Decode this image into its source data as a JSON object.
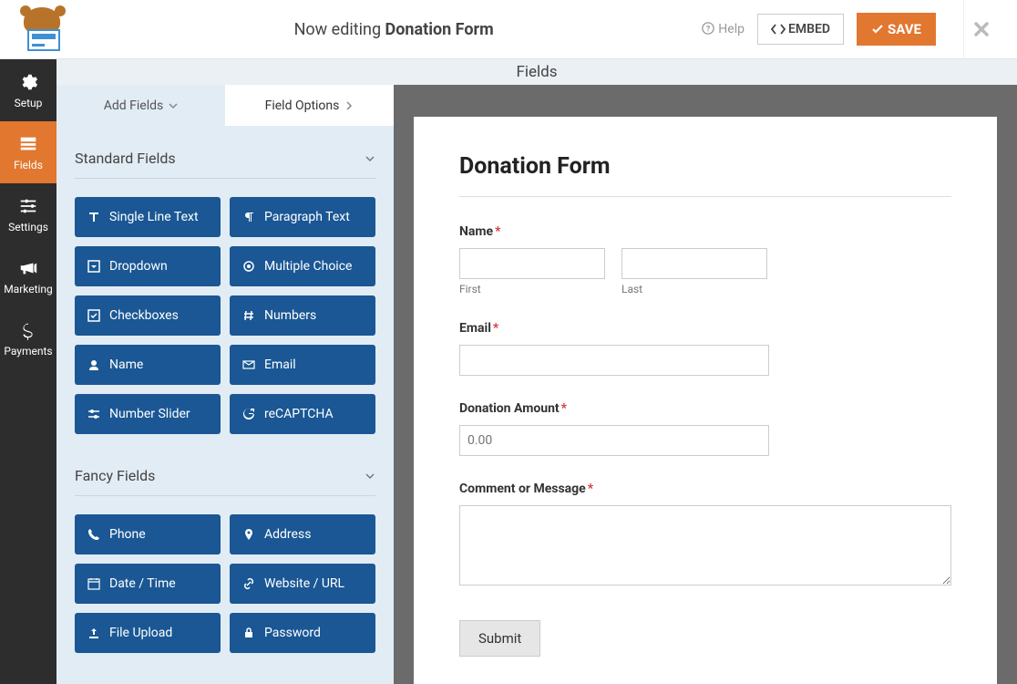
{
  "topbar": {
    "editing_prefix": "Now editing ",
    "form_name": "Donation Form",
    "help": "Help",
    "embed": "EMBED",
    "save": "SAVE"
  },
  "vnav": {
    "setup": "Setup",
    "fields": "Fields",
    "settings": "Settings",
    "marketing": "Marketing",
    "payments": "Payments"
  },
  "strip_title": "Fields",
  "panel_tabs": {
    "add": "Add Fields",
    "options": "Field Options"
  },
  "sections": {
    "standard": "Standard Fields",
    "fancy": "Fancy Fields"
  },
  "standard_fields": {
    "single_line": "Single Line Text",
    "paragraph": "Paragraph Text",
    "dropdown": "Dropdown",
    "multiple_choice": "Multiple Choice",
    "checkboxes": "Checkboxes",
    "numbers": "Numbers",
    "name": "Name",
    "email": "Email",
    "number_slider": "Number Slider",
    "recaptcha": "reCAPTCHA"
  },
  "fancy_fields": {
    "phone": "Phone",
    "address": "Address",
    "date_time": "Date / Time",
    "website_url": "Website / URL",
    "file_upload": "File Upload",
    "password": "Password"
  },
  "preview": {
    "title": "Donation Form",
    "name_label": "Name",
    "first": "First",
    "last": "Last",
    "email_label": "Email",
    "amount_label": "Donation Amount",
    "amount_placeholder": "0.00",
    "comment_label": "Comment or Message",
    "submit": "Submit"
  }
}
